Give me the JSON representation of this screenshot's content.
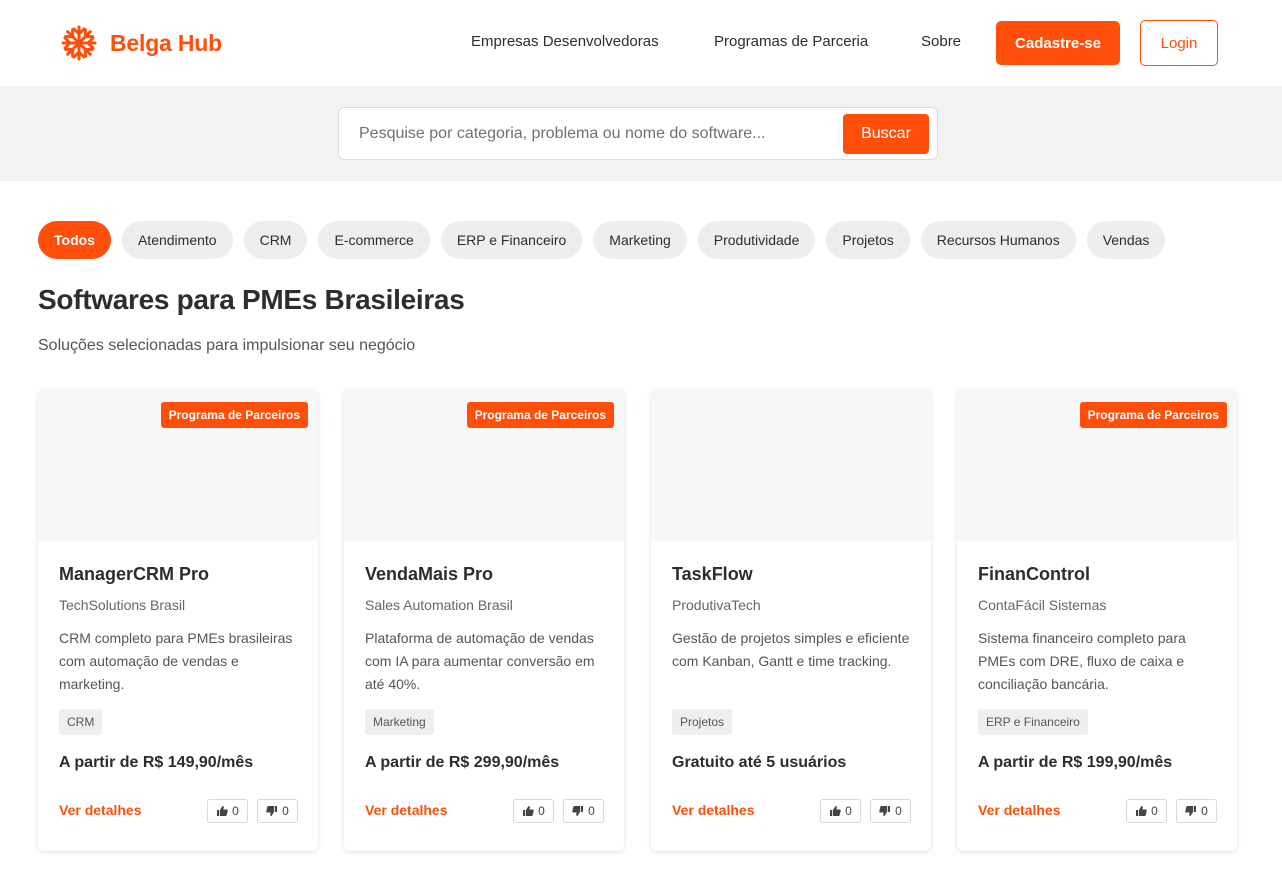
{
  "brand": {
    "name": "Belga Hub",
    "icon": "snowflake-icon",
    "accent": "#ff4f0a"
  },
  "nav": {
    "links": [
      "Empresas Desenvolvedoras",
      "Programas de Parceria",
      "Sobre"
    ],
    "signup_label": "Cadastre-se",
    "login_label": "Login"
  },
  "search": {
    "placeholder": "Pesquise por categoria, problema ou nome do software...",
    "value": "",
    "button_label": "Buscar"
  },
  "categories": {
    "selected": "Todos",
    "items": [
      "Todos",
      "Atendimento",
      "CRM",
      "E-commerce",
      "ERP e Financeiro",
      "Marketing",
      "Produtividade",
      "Projetos",
      "Recursos Humanos",
      "Vendas"
    ]
  },
  "section": {
    "title": "Softwares para PMEs Brasileiras",
    "subtitle": "Soluções selecionadas para impulsionar seu negócio"
  },
  "cards": [
    {
      "badge": "Programa de Parceiros",
      "title": "ManagerCRM Pro",
      "company": "TechSolutions Brasil",
      "description": "CRM completo para PMEs brasileiras com automação de vendas e marketing.",
      "tag": "CRM",
      "price": "A partir de R$ 149,90/mês",
      "link": "Ver detalhes",
      "likes": "0",
      "dislikes": "0"
    },
    {
      "badge": "Programa de Parceiros",
      "title": "VendaMais Pro",
      "company": "Sales Automation Brasil",
      "description": "Plataforma de automação de vendas com IA para aumentar conversão em até 40%.",
      "tag": "Marketing",
      "price": "A partir de R$ 299,90/mês",
      "link": "Ver detalhes",
      "likes": "0",
      "dislikes": "0"
    },
    {
      "badge": "",
      "title": "TaskFlow",
      "company": "ProdutivaTech",
      "description": "Gestão de projetos simples e eficiente com Kanban, Gantt e time tracking.",
      "tag": "Projetos",
      "price": "Gratuito até 5 usuários",
      "link": "Ver detalhes",
      "likes": "0",
      "dislikes": "0"
    },
    {
      "badge": "Programa de Parceiros",
      "title": "FinanControl",
      "company": "ContaFácil Sistemas",
      "description": "Sistema financeiro completo para PMEs com DRE, fluxo de caixa e conciliação bancária.",
      "tag": "ERP e Financeiro",
      "price": "A partir de R$ 199,90/mês",
      "link": "Ver detalhes",
      "likes": "0",
      "dislikes": "0"
    }
  ]
}
